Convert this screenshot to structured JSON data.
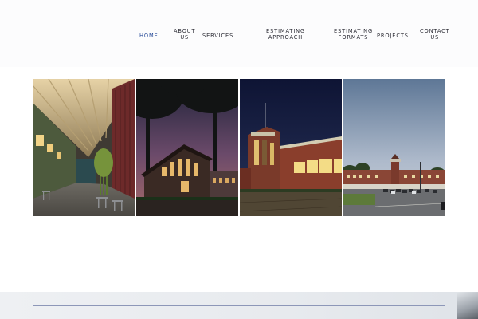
{
  "nav": {
    "home": [
      "HOME"
    ],
    "about": [
      "ABOUT",
      "US"
    ],
    "services": [
      "SERVICES"
    ],
    "estimating_approach": [
      "ESTIMATING",
      "APPROACH"
    ],
    "estimating_formats": [
      "ESTIMATING",
      "FORMATS"
    ],
    "projects": [
      "PROJECTS"
    ],
    "contact": [
      "CONTACT",
      "US"
    ],
    "active_item": "home",
    "active_color": "#2a4d9a"
  },
  "gallery": {
    "photos": [
      {
        "subject": "covered courtyard walkway with bamboo and patio seating"
      },
      {
        "subject": "modern building at dusk framed by trees"
      },
      {
        "subject": "brick school building lit at night"
      },
      {
        "subject": "brick campus building with clock tower and parking lot at dusk"
      }
    ]
  },
  "colors": {
    "header_bg": "#fcfcfd",
    "footer_rule": "#8d97b8"
  }
}
